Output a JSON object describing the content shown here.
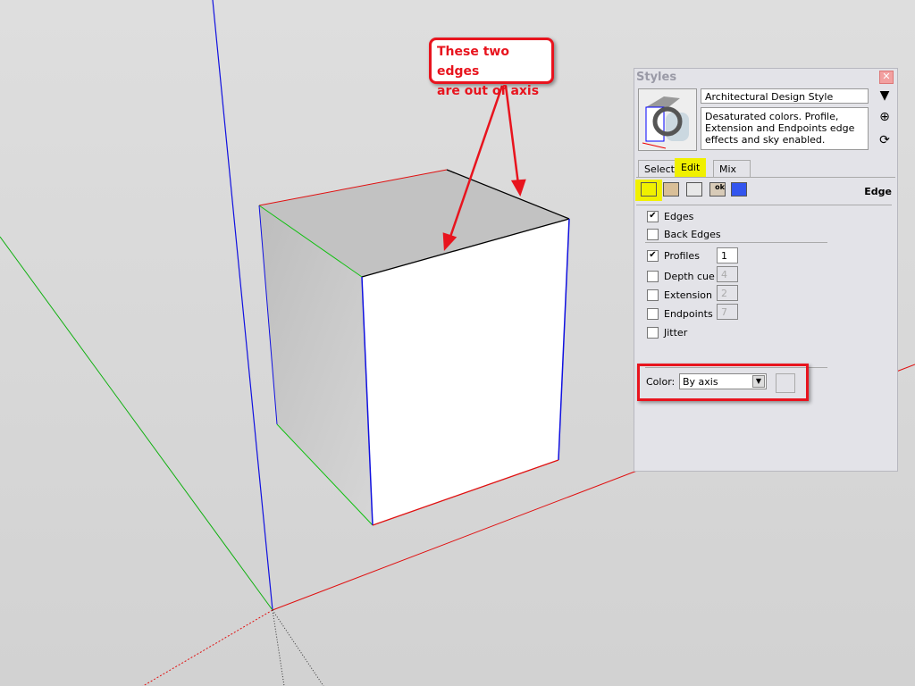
{
  "callout": {
    "line1": "These two edges",
    "line2": "are out of axis",
    "color": "#e8141e"
  },
  "panel": {
    "title": "Styles",
    "close_icon": "close-icon",
    "style_name": "Architectural Design Style",
    "style_description": "Desaturated colors. Profile, Extension and Endpoints edge effects and sky enabled.",
    "tabs": [
      {
        "label": "Select"
      },
      {
        "label": "Edit",
        "active": true
      },
      {
        "label": "Mix"
      }
    ],
    "section_label": "Edge",
    "tool_icons": [
      "edge-settings-icon",
      "face-settings-icon",
      "background-settings-icon",
      "watermark-settings-icon",
      "modeling-settings-icon"
    ],
    "options": [
      {
        "label": "Edges",
        "checked": true
      },
      {
        "label": "Back Edges",
        "checked": false
      },
      {
        "label": "Profiles",
        "checked": true,
        "value": "1"
      },
      {
        "label": "Depth cue",
        "checked": false,
        "value": "4"
      },
      {
        "label": "Extension",
        "checked": false,
        "value": "2"
      },
      {
        "label": "Endpoints",
        "checked": false,
        "value": "7"
      },
      {
        "label": "Jitter",
        "checked": false
      }
    ],
    "color_label": "Color:",
    "color_value": "By axis",
    "highlight": "#f0f000"
  }
}
